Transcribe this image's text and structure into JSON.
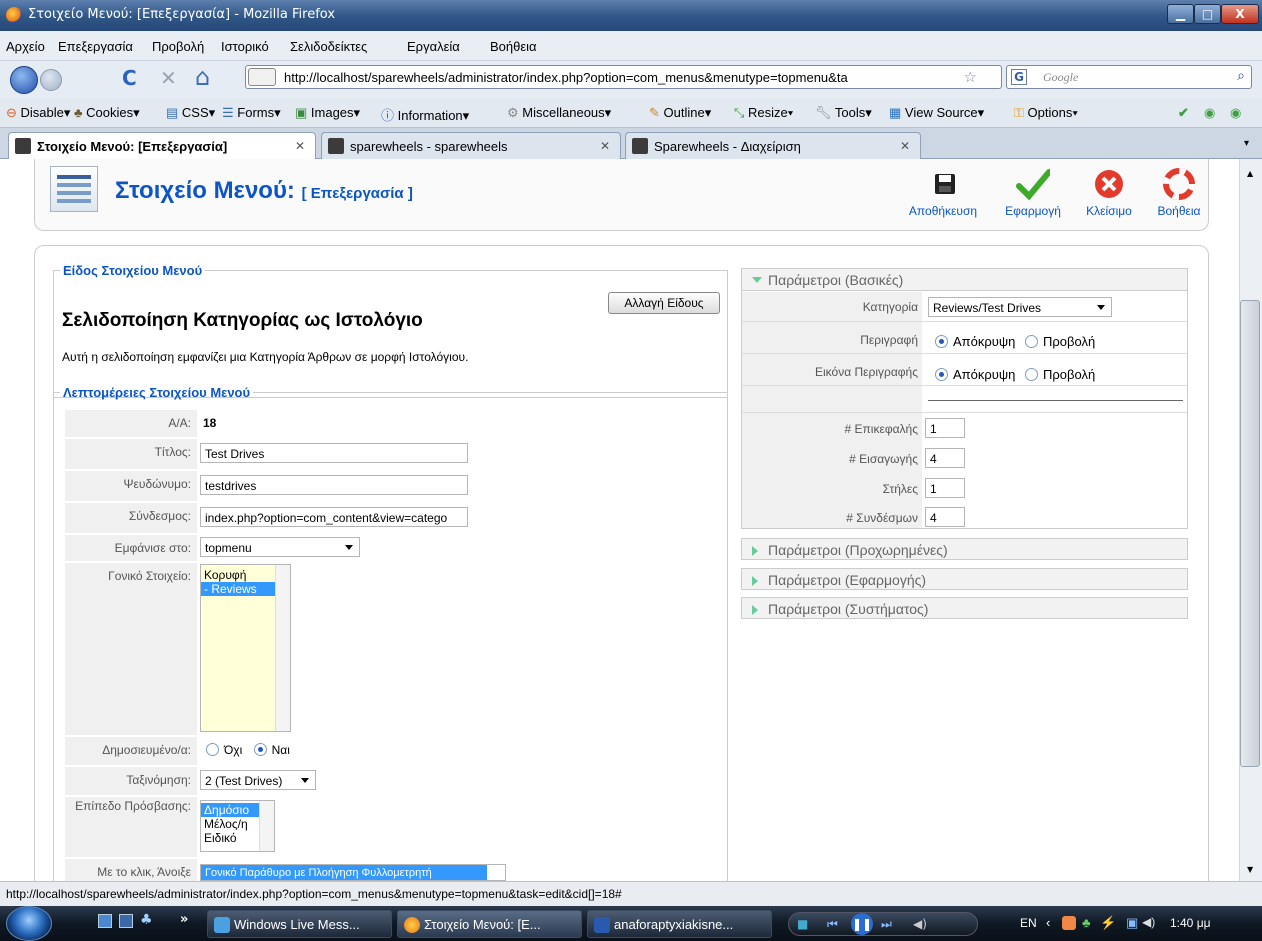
{
  "window": {
    "title": "Στοιχείο Μενού: [Επεξεργασία] - Mozilla Firefox",
    "minimize": "▁",
    "maximize": "□",
    "close": "X"
  },
  "menubar": [
    "Αρχείο",
    "Επεξεργασία",
    "Προβολή",
    "Ιστορικό",
    "Σελιδοδείκτες",
    "Εργαλεία",
    "Βοήθεια"
  ],
  "nav": {
    "url": "http://localhost/sparewheels/administrator/index.php?option=com_menus&menutype=topmenu&ta",
    "search_placeholder": "Google",
    "search_engine": "G",
    "reload": "C",
    "stop": "✕",
    "home": "⌂",
    "star": "☆"
  },
  "devbar": [
    "Disable",
    "Cookies",
    "CSS",
    "Forms",
    "Images",
    "Information",
    "Miscellaneous",
    "Outline",
    "Resize",
    "Tools",
    "View Source",
    "Options"
  ],
  "tabs": [
    {
      "label": "Στοιχείο Μενού: [Επεξεργασία]"
    },
    {
      "label": "sparewheels - sparewheels"
    },
    {
      "label": "Sparewheels - Διαχείριση"
    }
  ],
  "header": {
    "title": "Στοιχείο Μενού:",
    "subtitle": "[ Επεξεργασία ]"
  },
  "toolbar": {
    "save": "Αποθήκευση",
    "apply": "Εφαρμογή",
    "close": "Κλείσιμο",
    "help": "Βοήθεια"
  },
  "type_section": {
    "legend": "Είδος Στοιχείου Μενού",
    "change_button": "Αλλαγή Είδους",
    "type_title": "Σελιδοποίηση Κατηγορίας ως Ιστολόγιο",
    "description": "Αυτή η σελιδοποίηση εμφανίζει μια Κατηγορία Άρθρων σε μορφή Ιστολόγιου."
  },
  "details": {
    "legend": "Λεπτομέρειες Στοιχείου Μενού",
    "id_label": "Α/Α:",
    "id_value": "18",
    "title_label": "Τίτλος:",
    "title_value": "Test Drives",
    "alias_label": "Ψευδώνυμο:",
    "alias_value": "testdrives",
    "link_label": "Σύνδεσμος:",
    "link_value": "index.php?option=com_content&view=catego",
    "menu_label": "Εμφάνισε στο:",
    "menu_value": "topmenu",
    "parent_label": "Γονικό Στοιχείο:",
    "parent_options": [
      "Κορυφή",
      "- Reviews"
    ],
    "published_label": "Δημοσιευμένο/α:",
    "published_no": "Όχι",
    "published_yes": "Ναι",
    "order_label": "Ταξινόμηση:",
    "order_value": "2 (Test Drives)",
    "access_label": "Επίπεδο Πρόσβασης:",
    "access_options": [
      "Δημόσιο",
      "Μέλος/η",
      "Ειδικό"
    ],
    "onclick_label": "Με το κλικ, Άνοιξε",
    "onclick_value": "Γονικό Παράθυρο με Πλοήγηση Φυλλομετρητή"
  },
  "params": {
    "basic_title": "Παράμετροι (Βασικές)",
    "category_label": "Κατηγορία",
    "category_value": "Reviews/Test Drives",
    "desc_label": "Περιγραφή",
    "hide": "Απόκρυψη",
    "show": "Προβολή",
    "desc_image_label": "Εικόνα Περιγραφής",
    "leading_label": "# Επικεφαλής",
    "leading_value": "1",
    "intro_label": "# Εισαγωγής",
    "intro_value": "4",
    "columns_label": "Στήλες",
    "columns_value": "1",
    "links_label": "# Συνδέσμων",
    "links_value": "4",
    "advanced_title": "Παράμετροι (Προχωρημένες)",
    "component_title": "Παράμετροι (Εφαρμογής)",
    "system_title": "Παράμετροι (Συστήματος)"
  },
  "status": "http://localhost/sparewheels/administrator/index.php?option=com_menus&menutype=topmenu&task=edit&cid[]=18#",
  "taskbar": {
    "items": [
      "Windows Live Mess...",
      "Στοιχείο Μενού: [E...",
      "anaforaptyxiakisne..."
    ],
    "lang": "EN",
    "time": "1:40 μμ",
    "chevron": "»"
  },
  "colors": {
    "accent": "#0b55c4",
    "params_text": "#666666"
  }
}
